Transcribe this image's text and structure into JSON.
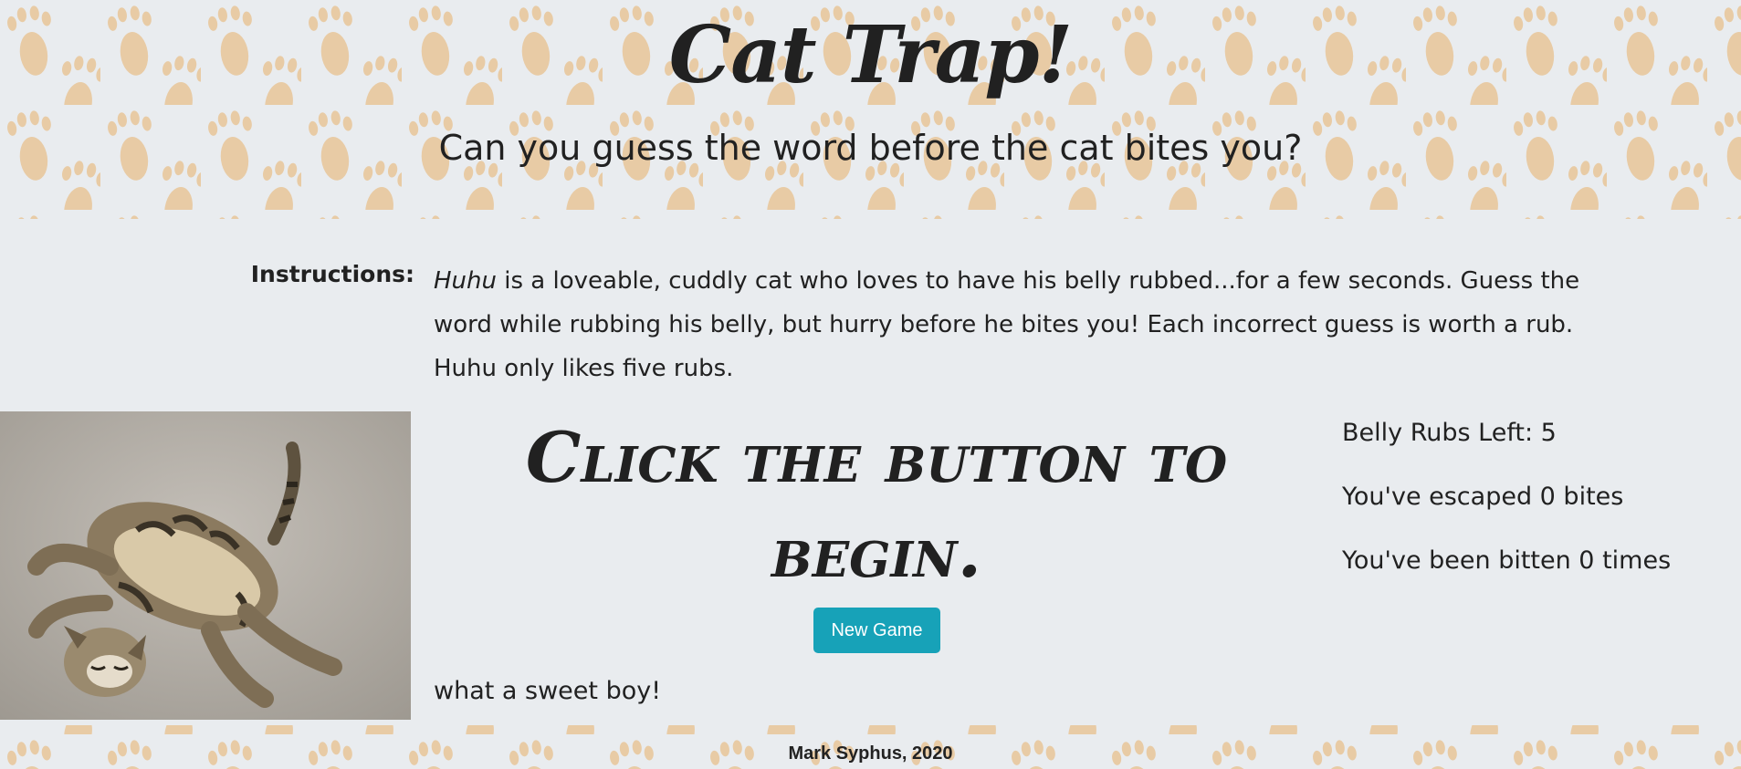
{
  "header": {
    "title": "Cat Trap!",
    "subtitle": "Can you guess the word before the cat bites you?"
  },
  "instructions": {
    "label": "Instructions:",
    "cat_name": "Huhu",
    "text": " is a loveable, cuddly cat who loves to have his belly rubbed...for a few seconds. Guess the word while rubbing his belly, but hurry before he bites you! Each incorrect guess is worth a rub. Huhu only likes five rubs."
  },
  "game": {
    "prompt": "Click the button to begin.",
    "new_game_label": "New Game",
    "photo_caption": "what a sweet boy!"
  },
  "stats": {
    "rubs_left": "Belly Rubs Left: 5",
    "escaped": "You've escaped 0 bites",
    "bitten": "You've been bitten 0 times"
  },
  "footer": {
    "credit": "Mark Syphus, 2020"
  },
  "colors": {
    "background": "#e9ecef",
    "paw_print": "#e8cba5",
    "button": "#17a2b8",
    "text": "#212121"
  }
}
